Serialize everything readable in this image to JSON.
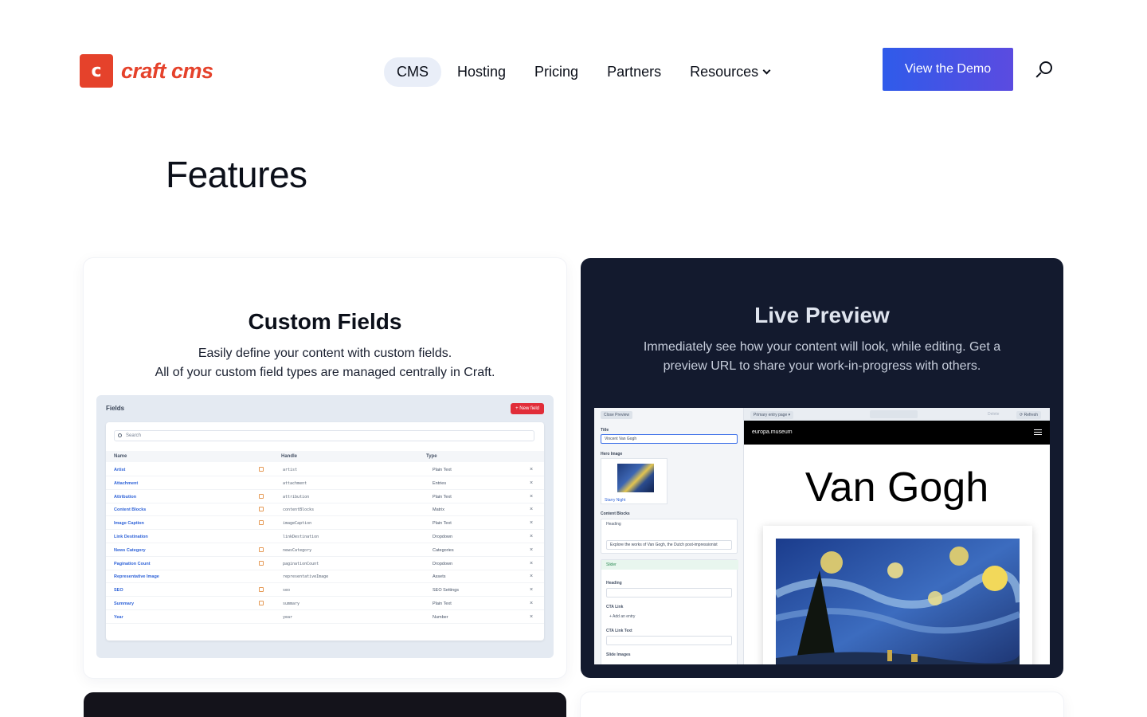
{
  "brand": {
    "logo_letter": "c",
    "name": "craft cms",
    "color": "#e5422b"
  },
  "nav": {
    "items": [
      {
        "label": "CMS",
        "active": true
      },
      {
        "label": "Hosting"
      },
      {
        "label": "Pricing"
      },
      {
        "label": "Partners"
      },
      {
        "label": "Resources",
        "has_dropdown": true
      }
    ]
  },
  "header": {
    "demo_label": "View the Demo",
    "search_icon": "search-icon"
  },
  "page": {
    "title": "Features"
  },
  "cards": {
    "custom_fields": {
      "title": "Custom Fields",
      "desc_line1": "Easily define your content with custom fields.",
      "desc_line2": "All of your custom field types are managed centrally in Craft.",
      "screenshot": {
        "heading": "Fields",
        "new_button": "+ New field",
        "search_placeholder": "Search",
        "columns": [
          "Name",
          "Handle",
          "Type"
        ],
        "rows": [
          {
            "name": "Artist",
            "handle": "artist",
            "type": "Plain Text",
            "flag": true
          },
          {
            "name": "Attachment",
            "handle": "attachment",
            "type": "Entries",
            "flag": false
          },
          {
            "name": "Attribution",
            "handle": "attribution",
            "type": "Plain Text",
            "flag": true
          },
          {
            "name": "Content Blocks",
            "handle": "contentBlocks",
            "type": "Matrix",
            "flag": true
          },
          {
            "name": "Image Caption",
            "handle": "imageCaption",
            "type": "Plain Text",
            "flag": true
          },
          {
            "name": "Link Destination",
            "handle": "linkDestination",
            "type": "Dropdown",
            "flag": false
          },
          {
            "name": "News Category",
            "handle": "newsCategory",
            "type": "Categories",
            "flag": true
          },
          {
            "name": "Pagination Count",
            "handle": "paginationCount",
            "type": "Dropdown",
            "flag": true
          },
          {
            "name": "Representative Image",
            "handle": "representativeImage",
            "type": "Assets",
            "flag": false
          },
          {
            "name": "SEO",
            "handle": "seo",
            "type": "SEO Settings",
            "flag": true
          },
          {
            "name": "Summary",
            "handle": "summary",
            "type": "Plain Text",
            "flag": true
          },
          {
            "name": "Year",
            "handle": "year",
            "type": "Number",
            "flag": false
          }
        ]
      }
    },
    "live_preview": {
      "title": "Live Preview",
      "desc_line1": "Immediately see how your content will look, while editing. Get a",
      "desc_line2": "preview URL to share your work-in-progress with others.",
      "screenshot": {
        "close_label": "Close Preview",
        "entry_page": "Primary entry page ▾",
        "refresh_label": "⟳ Refresh",
        "delete_label": "Delete",
        "title_label": "Title",
        "title_value": "Vincent Van Gogh",
        "hero_label": "Hero Image",
        "hero_caption": "Starry Night",
        "blocks_label": "Content Blocks",
        "block1_title": "Heading",
        "block1_text": "Explore the works of Van Gogh, the Dutch post-impressionist",
        "block2_title": "Slider",
        "heading_label": "Heading",
        "cta_link_label": "CTA Link",
        "add_entry": "+ Add an entry",
        "cta_text_label": "CTA Link Text",
        "slide_images_label": "Slide Images",
        "site_brand": "europa.museum",
        "site_heading": "Van Gogh"
      }
    }
  }
}
